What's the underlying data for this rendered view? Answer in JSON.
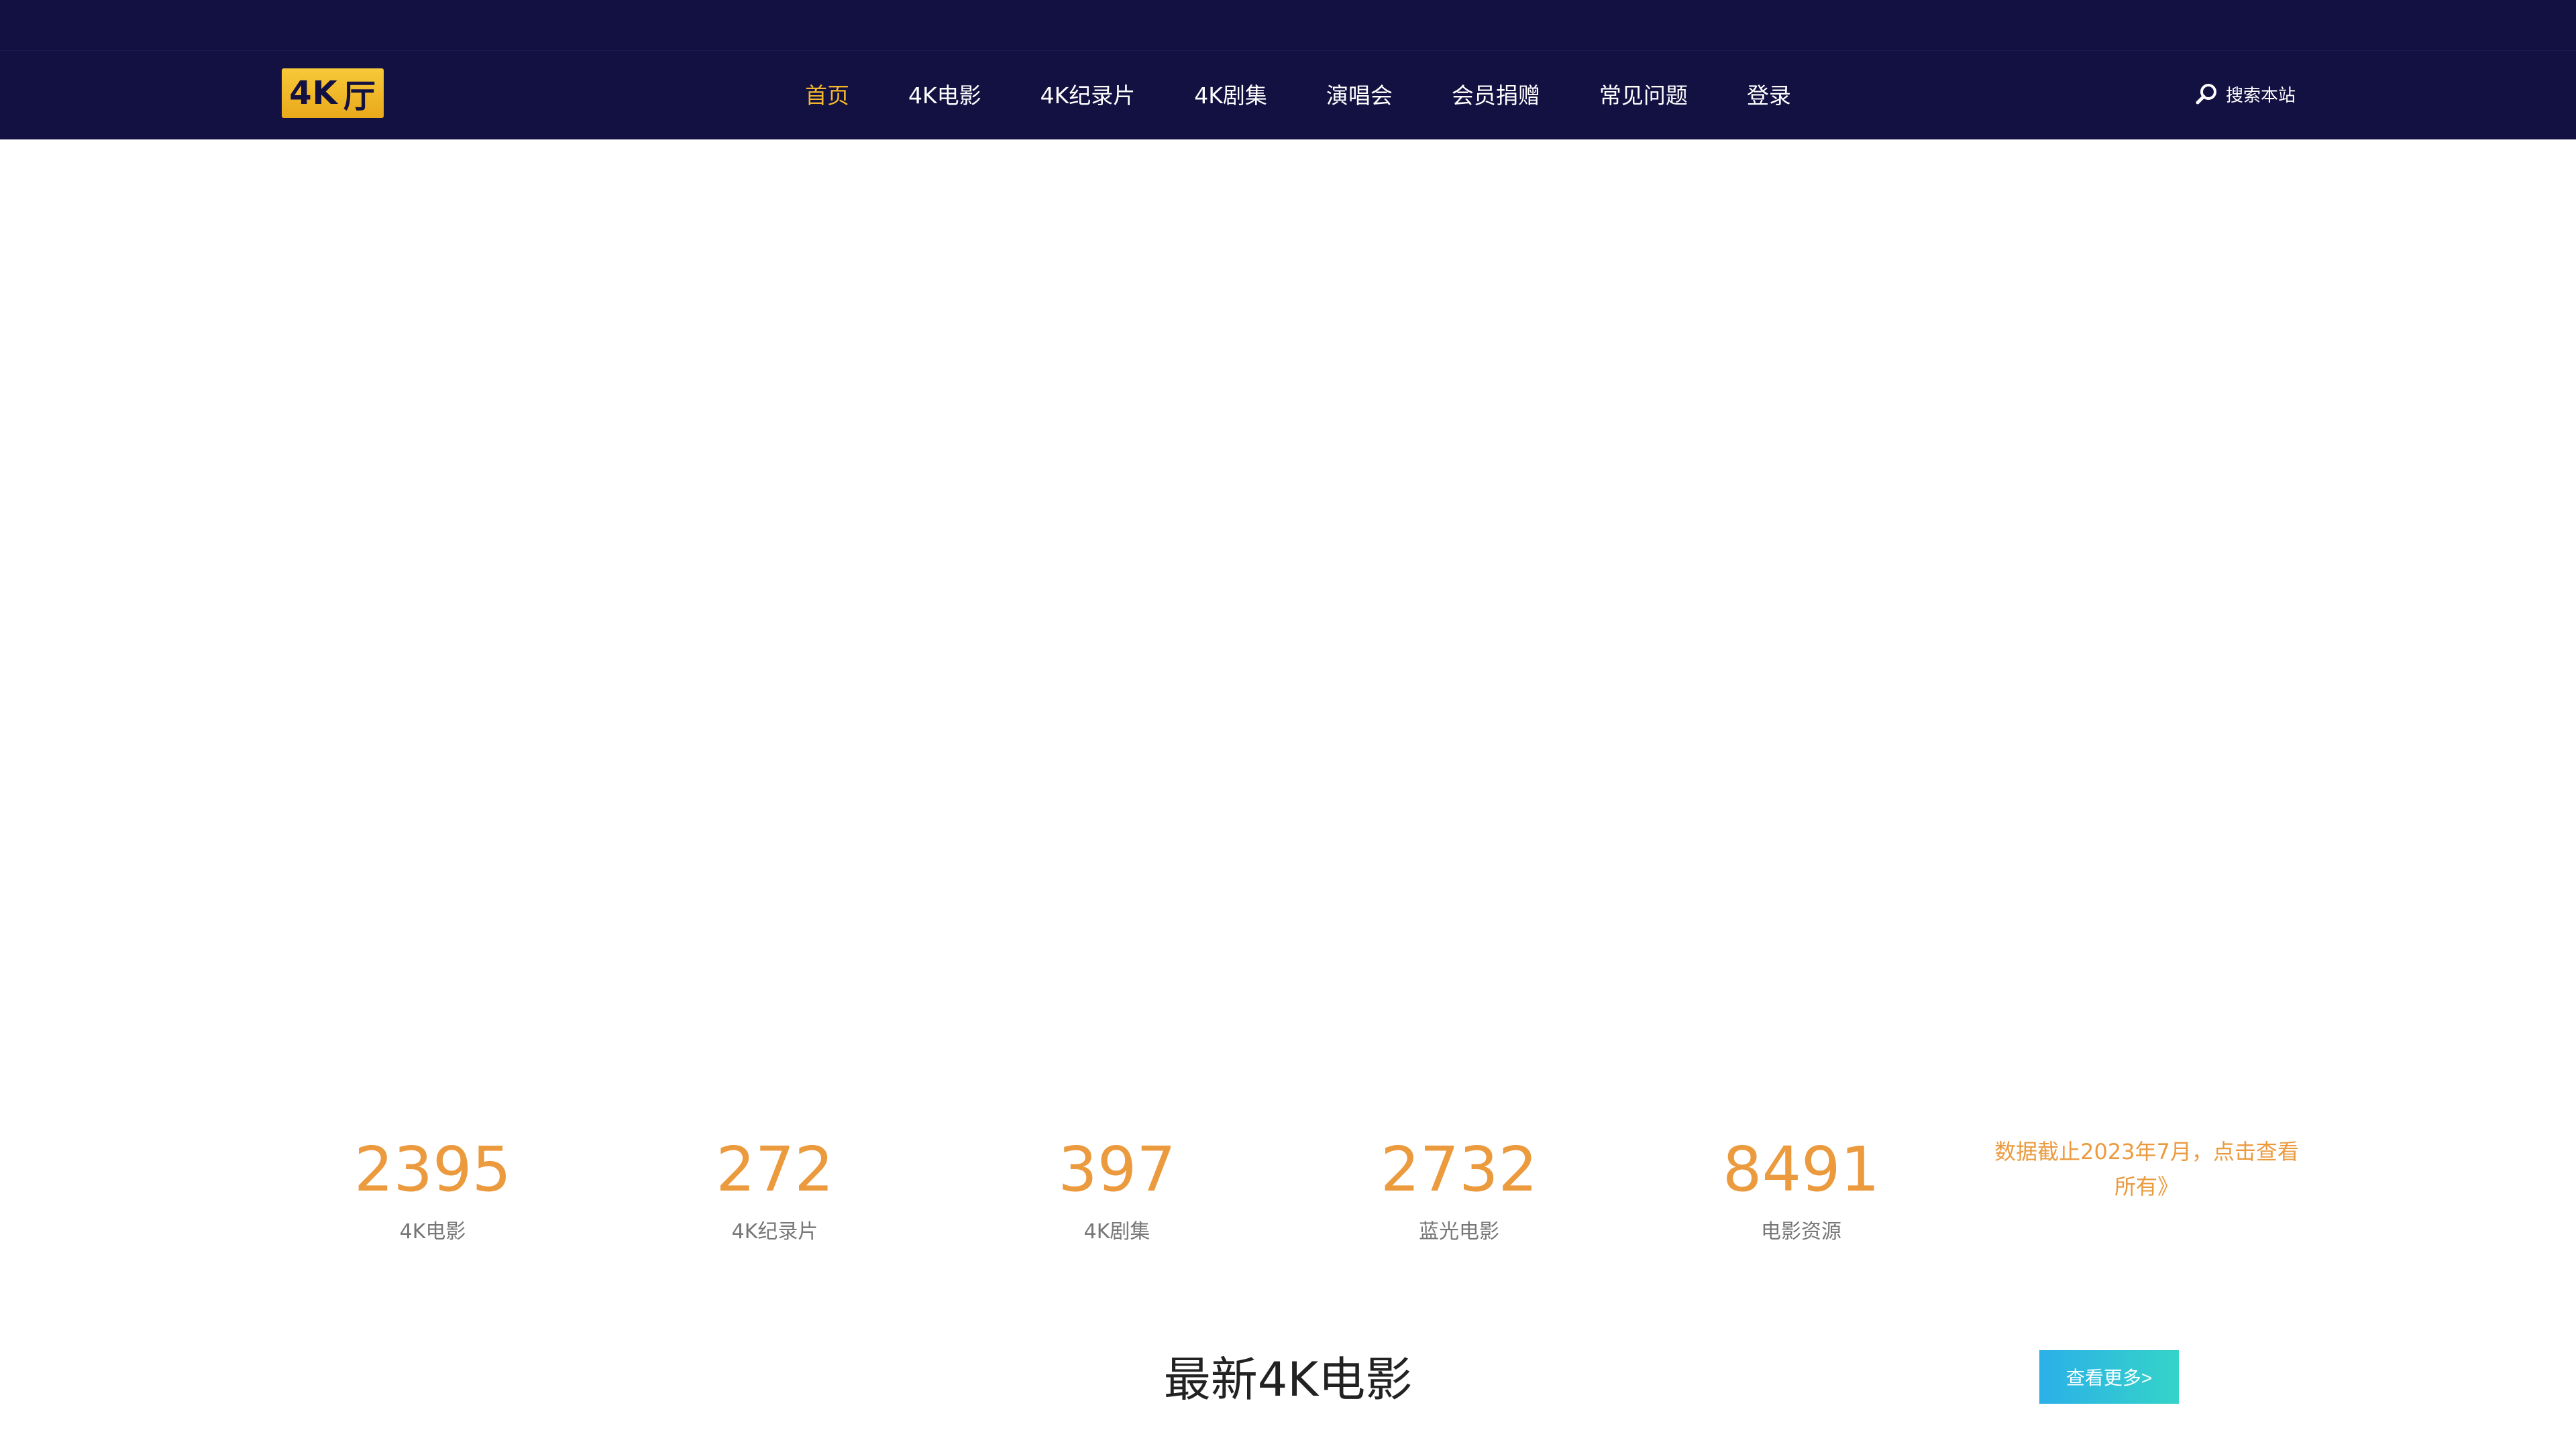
{
  "header": {
    "logo": {
      "text_4k": "4K",
      "text_ting": "厅"
    },
    "nav": [
      {
        "label": "首页",
        "active": true
      },
      {
        "label": "4K电影"
      },
      {
        "label": "4K纪录片"
      },
      {
        "label": "4K剧集"
      },
      {
        "label": "演唱会"
      },
      {
        "label": "会员捐赠"
      },
      {
        "label": "常见问题"
      },
      {
        "label": "登录"
      }
    ],
    "search": {
      "label": "搜索本站",
      "icon": "search-icon"
    },
    "colors": {
      "background": "#131042",
      "active": "#f2b72c",
      "text": "#ffffff"
    }
  },
  "stats": [
    {
      "value": "2395",
      "label": "4K电影"
    },
    {
      "value": "272",
      "label": "4K纪录片"
    },
    {
      "value": "397",
      "label": "4K剧集"
    },
    {
      "value": "2732",
      "label": "蓝光电影"
    },
    {
      "value": "8491",
      "label": "电影资源"
    }
  ],
  "stats_note": "数据截止2023年7月，点击查看所有》",
  "stats_color": "#eb9a3e",
  "latest": {
    "title": "最新4K电影",
    "more_label": "查看更多>"
  }
}
